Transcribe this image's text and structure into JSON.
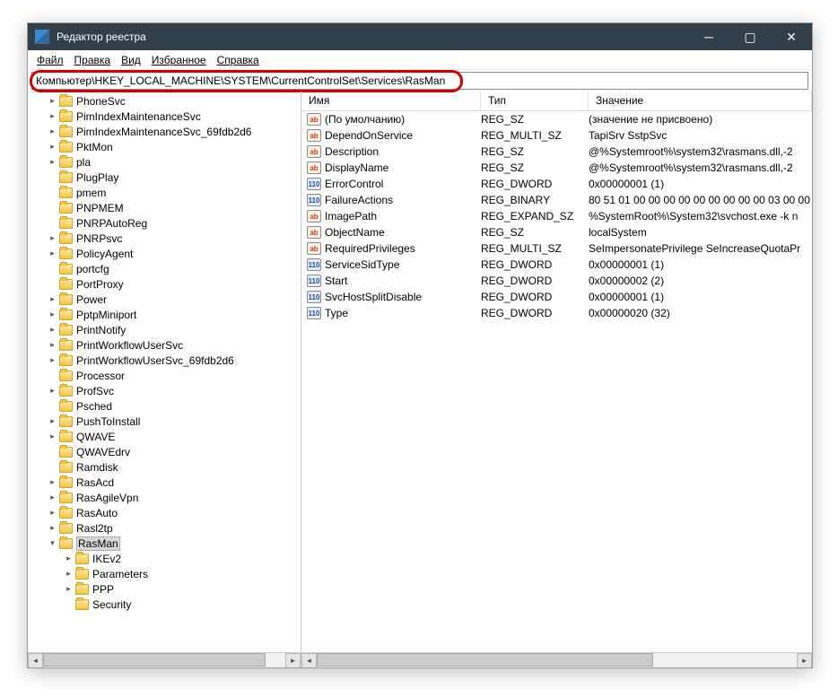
{
  "titlebar": {
    "title": "Редактор реестра"
  },
  "menu": {
    "file": "Файл",
    "edit": "Правка",
    "view": "Вид",
    "favorites": "Избранное",
    "help": "Справка"
  },
  "addressbar": {
    "path": "Компьютер\\HKEY_LOCAL_MACHINE\\SYSTEM\\CurrentControlSet\\Services\\RasMan"
  },
  "columns": {
    "name": "Имя",
    "type": "Тип",
    "data": "Значение"
  },
  "tree": {
    "items": [
      {
        "label": "PhoneSvc",
        "exp": "▸",
        "depth": 0
      },
      {
        "label": "PimIndexMaintenanceSvc",
        "exp": "▸",
        "depth": 0
      },
      {
        "label": "PimIndexMaintenanceSvc_69fdb2d6",
        "exp": "▸",
        "depth": 0
      },
      {
        "label": "PktMon",
        "exp": "▸",
        "depth": 0
      },
      {
        "label": "pla",
        "exp": "▸",
        "depth": 0
      },
      {
        "label": "PlugPlay",
        "exp": "",
        "depth": 0
      },
      {
        "label": "pmem",
        "exp": "",
        "depth": 0
      },
      {
        "label": "PNPMEM",
        "exp": "",
        "depth": 0
      },
      {
        "label": "PNRPAutoReg",
        "exp": "",
        "depth": 0
      },
      {
        "label": "PNRPsvc",
        "exp": "▸",
        "depth": 0
      },
      {
        "label": "PolicyAgent",
        "exp": "▸",
        "depth": 0
      },
      {
        "label": "portcfg",
        "exp": "",
        "depth": 0
      },
      {
        "label": "PortProxy",
        "exp": "",
        "depth": 0
      },
      {
        "label": "Power",
        "exp": "▸",
        "depth": 0
      },
      {
        "label": "PptpMiniport",
        "exp": "▸",
        "depth": 0
      },
      {
        "label": "PrintNotify",
        "exp": "▸",
        "depth": 0
      },
      {
        "label": "PrintWorkflowUserSvc",
        "exp": "▸",
        "depth": 0
      },
      {
        "label": "PrintWorkflowUserSvc_69fdb2d6",
        "exp": "▸",
        "depth": 0
      },
      {
        "label": "Processor",
        "exp": "",
        "depth": 0
      },
      {
        "label": "ProfSvc",
        "exp": "▸",
        "depth": 0
      },
      {
        "label": "Psched",
        "exp": "",
        "depth": 0
      },
      {
        "label": "PushToInstall",
        "exp": "▸",
        "depth": 0
      },
      {
        "label": "QWAVE",
        "exp": "▸",
        "depth": 0
      },
      {
        "label": "QWAVEdrv",
        "exp": "",
        "depth": 0
      },
      {
        "label": "Ramdisk",
        "exp": "",
        "depth": 0
      },
      {
        "label": "RasAcd",
        "exp": "▸",
        "depth": 0
      },
      {
        "label": "RasAgileVpn",
        "exp": "▸",
        "depth": 0
      },
      {
        "label": "RasAuto",
        "exp": "▸",
        "depth": 0
      },
      {
        "label": "Rasl2tp",
        "exp": "▸",
        "depth": 0
      },
      {
        "label": "RasMan",
        "exp": "▾",
        "depth": 0,
        "selected": true
      },
      {
        "label": "IKEv2",
        "exp": "▸",
        "depth": 1
      },
      {
        "label": "Parameters",
        "exp": "▸",
        "depth": 1
      },
      {
        "label": "PPP",
        "exp": "▸",
        "depth": 1
      },
      {
        "label": "Security",
        "exp": "",
        "depth": 1
      }
    ]
  },
  "values": [
    {
      "icon": "str",
      "name": "(По умолчанию)",
      "type": "REG_SZ",
      "data": "(значение не присвоено)"
    },
    {
      "icon": "str",
      "name": "DependOnService",
      "type": "REG_MULTI_SZ",
      "data": "TapiSrv SstpSvc"
    },
    {
      "icon": "str",
      "name": "Description",
      "type": "REG_SZ",
      "data": "@%Systemroot%\\system32\\rasmans.dll,-2"
    },
    {
      "icon": "str",
      "name": "DisplayName",
      "type": "REG_SZ",
      "data": "@%Systemroot%\\system32\\rasmans.dll,-2"
    },
    {
      "icon": "bin",
      "name": "ErrorControl",
      "type": "REG_DWORD",
      "data": "0x00000001 (1)"
    },
    {
      "icon": "bin",
      "name": "FailureActions",
      "type": "REG_BINARY",
      "data": "80 51 01 00 00 00 00 00 00 00 00 00 03 00 00 "
    },
    {
      "icon": "str",
      "name": "ImagePath",
      "type": "REG_EXPAND_SZ",
      "data": "%SystemRoot%\\System32\\svchost.exe -k n"
    },
    {
      "icon": "str",
      "name": "ObjectName",
      "type": "REG_SZ",
      "data": "localSystem"
    },
    {
      "icon": "str",
      "name": "RequiredPrivileges",
      "type": "REG_MULTI_SZ",
      "data": "SeImpersonatePrivilege SeIncreaseQuotaPr"
    },
    {
      "icon": "bin",
      "name": "ServiceSidType",
      "type": "REG_DWORD",
      "data": "0x00000001 (1)"
    },
    {
      "icon": "bin",
      "name": "Start",
      "type": "REG_DWORD",
      "data": "0x00000002 (2)"
    },
    {
      "icon": "bin",
      "name": "SvcHostSplitDisable",
      "type": "REG_DWORD",
      "data": "0x00000001 (1)"
    },
    {
      "icon": "bin",
      "name": "Type",
      "type": "REG_DWORD",
      "data": "0x00000020 (32)"
    }
  ]
}
